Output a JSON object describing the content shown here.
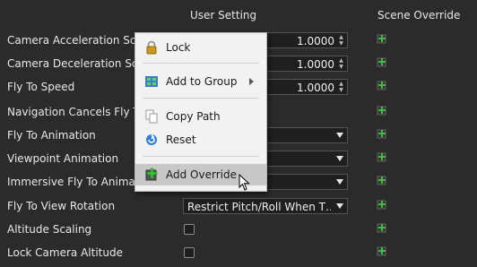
{
  "headers": {
    "user": "User Setting",
    "scene": "Scene Override"
  },
  "rows": [
    {
      "label": "Camera Acceleration Scale",
      "type": "spin",
      "value": "1.0000"
    },
    {
      "label": "Camera Deceleration Scale",
      "type": "spin",
      "value": "1.0000"
    },
    {
      "label": "Fly To Speed",
      "type": "spin",
      "value": "1.0000"
    },
    {
      "label": "Navigation Cancels Fly To",
      "type": "none",
      "value": ""
    },
    {
      "label": "Fly To Animation",
      "type": "dropdown",
      "value": ""
    },
    {
      "label": "Viewpoint Animation",
      "type": "dropdown",
      "value": ""
    },
    {
      "label": "Immersive Fly To Animation",
      "type": "dropdown",
      "value": ""
    },
    {
      "label": "Fly To View Rotation",
      "type": "dropdown",
      "value": "Restrict Pitch/Roll When T…"
    },
    {
      "label": "Altitude Scaling",
      "type": "checkbox",
      "checked": false
    },
    {
      "label": "Lock Camera Altitude",
      "type": "checkbox",
      "checked": false
    }
  ],
  "context_menu": {
    "items": [
      {
        "label": "Lock",
        "icon": "lock-icon"
      },
      {
        "label": "Add to Group",
        "icon": "group-icon",
        "submenu": true
      },
      {
        "label": "Copy Path",
        "icon": "copy-icon"
      },
      {
        "label": "Reset",
        "icon": "reset-icon"
      },
      {
        "label": "Add Override",
        "icon": "add-override-icon",
        "hovered": true
      }
    ]
  },
  "colors": {
    "background": "#2b2b2b",
    "menu_bg": "#f2f2f2",
    "menu_hover": "#c8c8c8",
    "override_green": "#3fbf3f"
  }
}
